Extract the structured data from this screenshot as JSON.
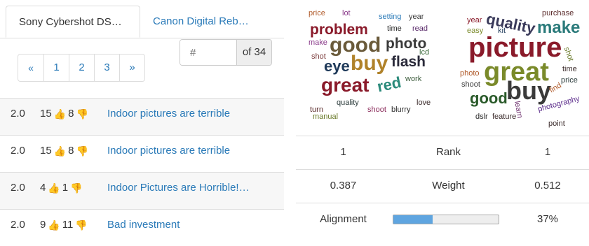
{
  "tabs": [
    {
      "label": "Sony Cybershot DS…",
      "active": true
    },
    {
      "label": "Canon Digital Reb…",
      "active": false
    }
  ],
  "pagination": {
    "first": "«",
    "pages": [
      "1",
      "2",
      "3"
    ],
    "next": "»"
  },
  "jump": {
    "placeholder": "#",
    "of_label": "of 34"
  },
  "reviews": [
    {
      "score": "2.0",
      "up": "15",
      "down": "8",
      "title": "Indoor pictures are terrible"
    },
    {
      "score": "2.0",
      "up": "15",
      "down": "8",
      "title": "Indoor pictures are terrible"
    },
    {
      "score": "2.0",
      "up": "4",
      "down": "1",
      "title": "Indoor Pictures are Horrible!…"
    },
    {
      "score": "2.0",
      "up": "9",
      "down": "11",
      "title": "Bad investment"
    }
  ],
  "cloud_left": [
    {
      "text": "price",
      "c": "#b05a2a"
    },
    {
      "text": "lot",
      "c": "#8a3b8a"
    },
    {
      "text": "setting",
      "c": "#2a7ab8"
    },
    {
      "text": "year",
      "c": "#3a3a3a"
    },
    {
      "text": "problem",
      "c": "#8a1a2a"
    },
    {
      "text": "time",
      "c": "#2a2a2a"
    },
    {
      "text": "read",
      "c": "#5a2a6a"
    },
    {
      "text": "make",
      "c": "#8a3b8a"
    },
    {
      "text": "good",
      "c": "#6a5a3a"
    },
    {
      "text": "photo",
      "c": "#3a3a3a"
    },
    {
      "text": "lcd",
      "c": "#3a6a3a"
    },
    {
      "text": "shot",
      "c": "#7a3a3a"
    },
    {
      "text": "eye",
      "c": "#1f3a5a"
    },
    {
      "text": "buy",
      "c": "#b0822a"
    },
    {
      "text": "flash",
      "c": "#2a2a3a"
    },
    {
      "text": "great",
      "c": "#8a1a2a"
    },
    {
      "text": "red",
      "c": "#2a8a7a"
    },
    {
      "text": "work",
      "c": "#3a5a3a"
    },
    {
      "text": "quality",
      "c": "#2a3a3a"
    },
    {
      "text": "love",
      "c": "#3a2a2a"
    },
    {
      "text": "turn",
      "c": "#5a2a2a"
    },
    {
      "text": "manual",
      "c": "#6a7a2a"
    },
    {
      "text": "shoot",
      "c": "#8a2a5a"
    },
    {
      "text": "blurry",
      "c": "#2a2a2a"
    }
  ],
  "cloud_right": [
    {
      "text": "year",
      "c": "#8a1a2a"
    },
    {
      "text": "quality",
      "c": "#3a3a5a"
    },
    {
      "text": "purchase",
      "c": "#5a2a2a"
    },
    {
      "text": "easy",
      "c": "#7a8a2a"
    },
    {
      "text": "kit",
      "c": "#1f3a5a"
    },
    {
      "text": "make",
      "c": "#2a7a7a"
    },
    {
      "text": "picture",
      "c": "#8a1a2a"
    },
    {
      "text": "shot",
      "c": "#6a7a2a"
    },
    {
      "text": "great",
      "c": "#7a8a2a"
    },
    {
      "text": "time",
      "c": "#3a2a2a"
    },
    {
      "text": "photo",
      "c": "#b05a2a"
    },
    {
      "text": "price",
      "c": "#2a3a3a"
    },
    {
      "text": "shoot",
      "c": "#3a3a3a"
    },
    {
      "text": "buy",
      "c": "#3a3a3a"
    },
    {
      "text": "good",
      "c": "#2a5a2a"
    },
    {
      "text": "find",
      "c": "#b05a2a"
    },
    {
      "text": "learn",
      "c": "#6a2a6a"
    },
    {
      "text": "photography",
      "c": "#5a2a8a"
    },
    {
      "text": "dslr",
      "c": "#2a2a2a"
    },
    {
      "text": "feature",
      "c": "#3a2a2a"
    },
    {
      "text": "point",
      "c": "#3a2a2a"
    }
  ],
  "stats": {
    "rank": {
      "left": "1",
      "label": "Rank",
      "right": "1"
    },
    "weight": {
      "left": "0.387",
      "label": "Weight",
      "right": "0.512"
    },
    "alignment": {
      "label": "Alignment",
      "value": "37%",
      "fraction": 0.37
    }
  }
}
